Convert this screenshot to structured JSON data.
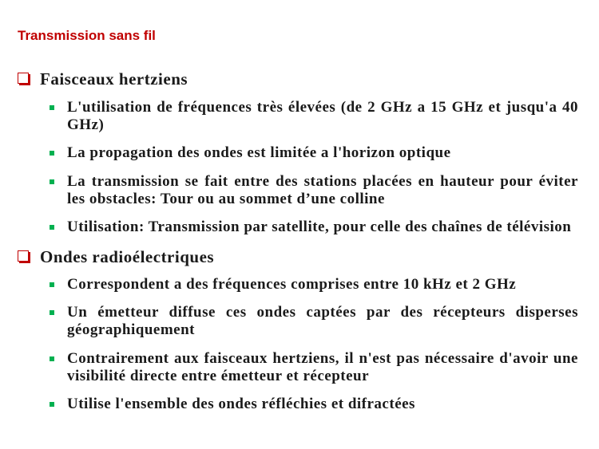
{
  "title": "Transmission sans fil",
  "colors": {
    "title": "#c00000",
    "heading_marker": "#c00000",
    "bullet_marker": "#00b050",
    "text": "#1a1a1a",
    "background": "#ffffff"
  },
  "icons": {
    "heading_marker": "hollow-square-checkbox-icon",
    "bullet_marker": "green-square-bullet-icon"
  },
  "sections": [
    {
      "heading": "Faisceaux hertziens",
      "bullets": [
        {
          "lines": [
            "L'utilisation de fréquences très élevées (de 2 GHz a 15 GHz et jusqu'a 40",
            "GHz)"
          ]
        },
        {
          "lines": [
            "La propagation des ondes est limitée a l'horizon optique"
          ]
        },
        {
          "lines": [
            "La transmission se fait entre des stations placées en hauteur pour éviter",
            "les obstacles: Tour ou au sommet d’une colline"
          ]
        },
        {
          "lines": [
            "Utilisation: Transmission par satellite, pour celle des chaînes de télévision"
          ]
        }
      ]
    },
    {
      "heading": "Ondes radioélectriques",
      "bullets": [
        {
          "lines": [
            "Correspondent a des fréquences comprises entre 10 kHz et 2 GHz"
          ]
        },
        {
          "lines": [
            "Un émetteur diffuse ces ondes captées par des récepteurs disperses",
            "géographiquement"
          ]
        },
        {
          "lines": [
            "Contrairement aux faisceaux hertziens, il n'est pas nécessaire d'avoir une",
            "visibilité directe entre émetteur et récepteur"
          ]
        },
        {
          "lines": [
            "Utilise l'ensemble des ondes réfléchies et difractées"
          ]
        }
      ]
    }
  ]
}
